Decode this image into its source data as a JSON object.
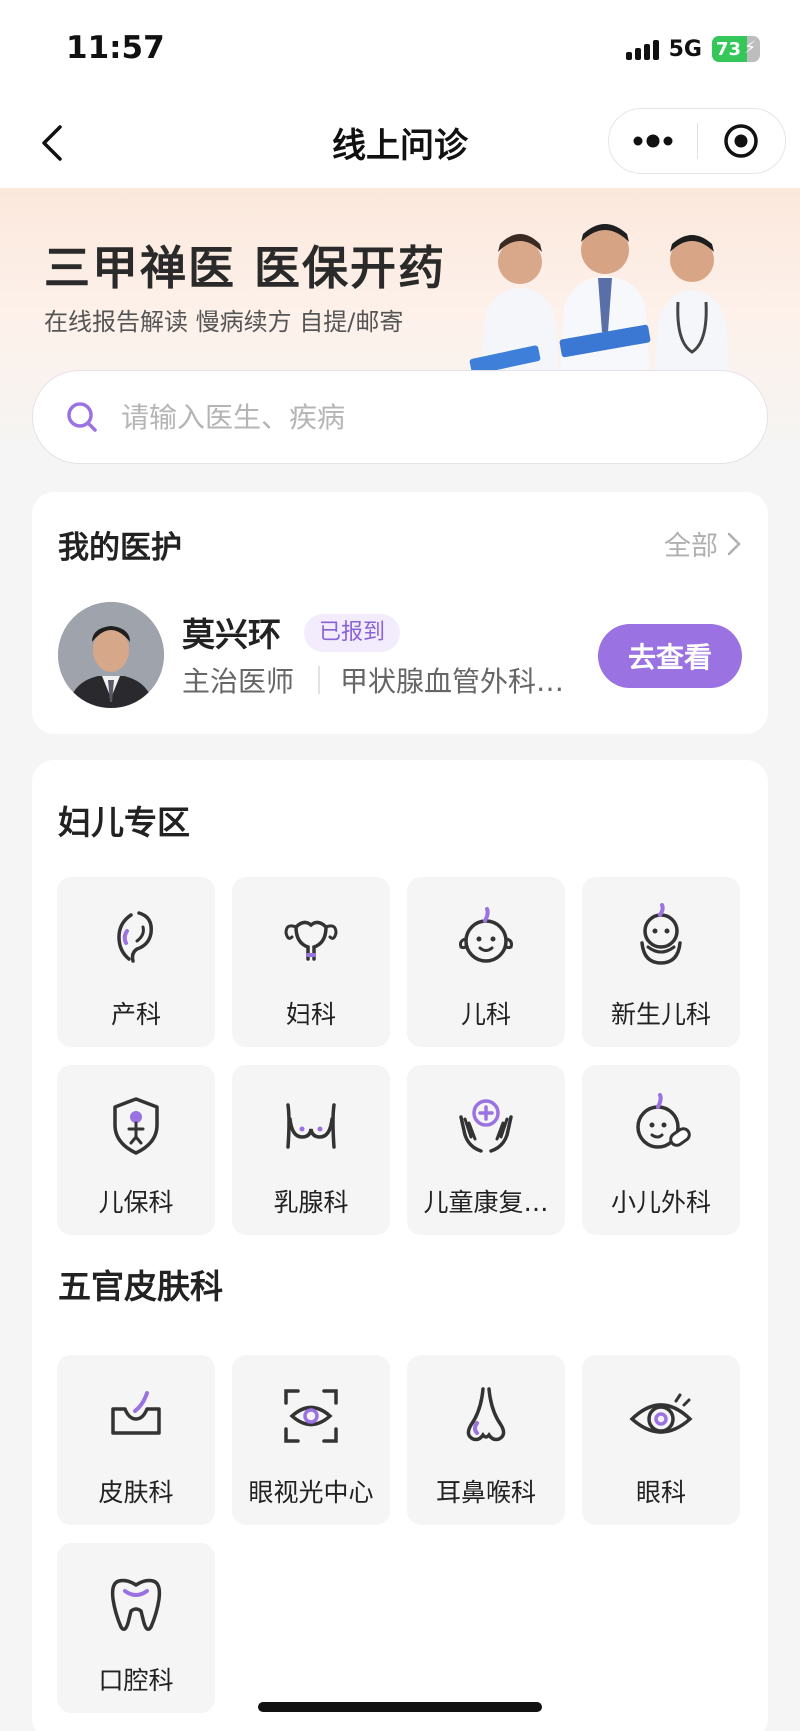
{
  "status_bar": {
    "time": "11:57",
    "network": "5G",
    "battery": "73"
  },
  "nav": {
    "title": "线上问诊"
  },
  "banner": {
    "title": "三甲禅医 医保开药",
    "subtitle": "在线报告解读 慢病续方 自提/邮寄"
  },
  "search": {
    "placeholder": "请输入医生、疾病"
  },
  "my_care": {
    "title": "我的医护",
    "all_label": "全部",
    "doctor": {
      "name": "莫兴环",
      "badge": "已报到",
      "role": "主治医师",
      "department": "甲状腺血管外科…",
      "action": "去查看"
    }
  },
  "sections": [
    {
      "title": "妇儿专区",
      "items": [
        {
          "label": "产科",
          "icon": "obstetrics-icon"
        },
        {
          "label": "妇科",
          "icon": "uterus-icon"
        },
        {
          "label": "儿科",
          "icon": "baby-face-icon"
        },
        {
          "label": "新生儿科",
          "icon": "newborn-icon"
        },
        {
          "label": "儿保科",
          "icon": "child-shield-icon"
        },
        {
          "label": "乳腺科",
          "icon": "breast-icon"
        },
        {
          "label": "儿童康复…",
          "icon": "care-hands-icon"
        },
        {
          "label": "小儿外科",
          "icon": "baby-pill-icon"
        }
      ]
    },
    {
      "title": "五官皮肤科",
      "items": [
        {
          "label": "皮肤科",
          "icon": "skin-icon"
        },
        {
          "label": "眼视光中心",
          "icon": "eye-scan-icon"
        },
        {
          "label": "耳鼻喉科",
          "icon": "nose-icon"
        },
        {
          "label": "眼科",
          "icon": "eye-icon"
        },
        {
          "label": "口腔科",
          "icon": "tooth-icon"
        }
      ]
    }
  ],
  "colors": {
    "accent": "#9b72e2",
    "accent_light": "#f2ecfd",
    "icon_stroke": "#333333",
    "icon_accent": "#9b72e2"
  }
}
